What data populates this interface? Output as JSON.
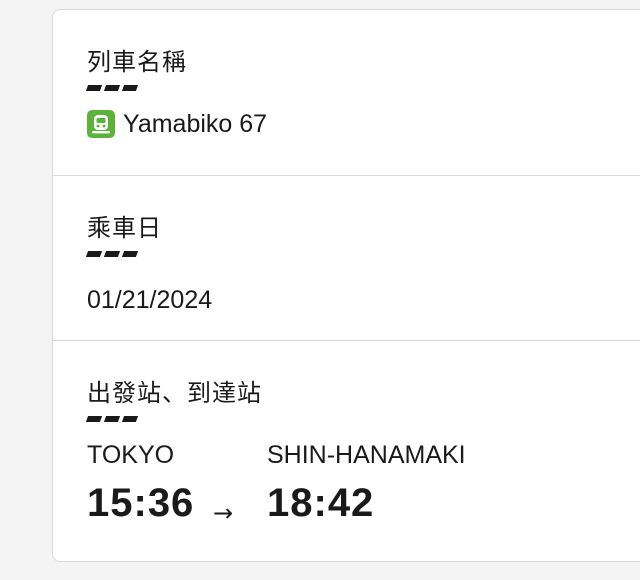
{
  "train": {
    "heading": "列車名稱",
    "icon": "train-icon",
    "name": "Yamabiko 67"
  },
  "date": {
    "heading": "乘車日",
    "value": "01/21/2024"
  },
  "route": {
    "heading": "出發站、到達站",
    "departure_station": "TOKYO",
    "arrival_station": "SHIN-HANAMAKI",
    "departure_time": "15:36",
    "arrival_time": "18:42",
    "arrow": "→"
  },
  "colors": {
    "train_icon_bg": "#5bb33a",
    "text": "#1a1a1a",
    "divider": "#d9d9d9"
  }
}
